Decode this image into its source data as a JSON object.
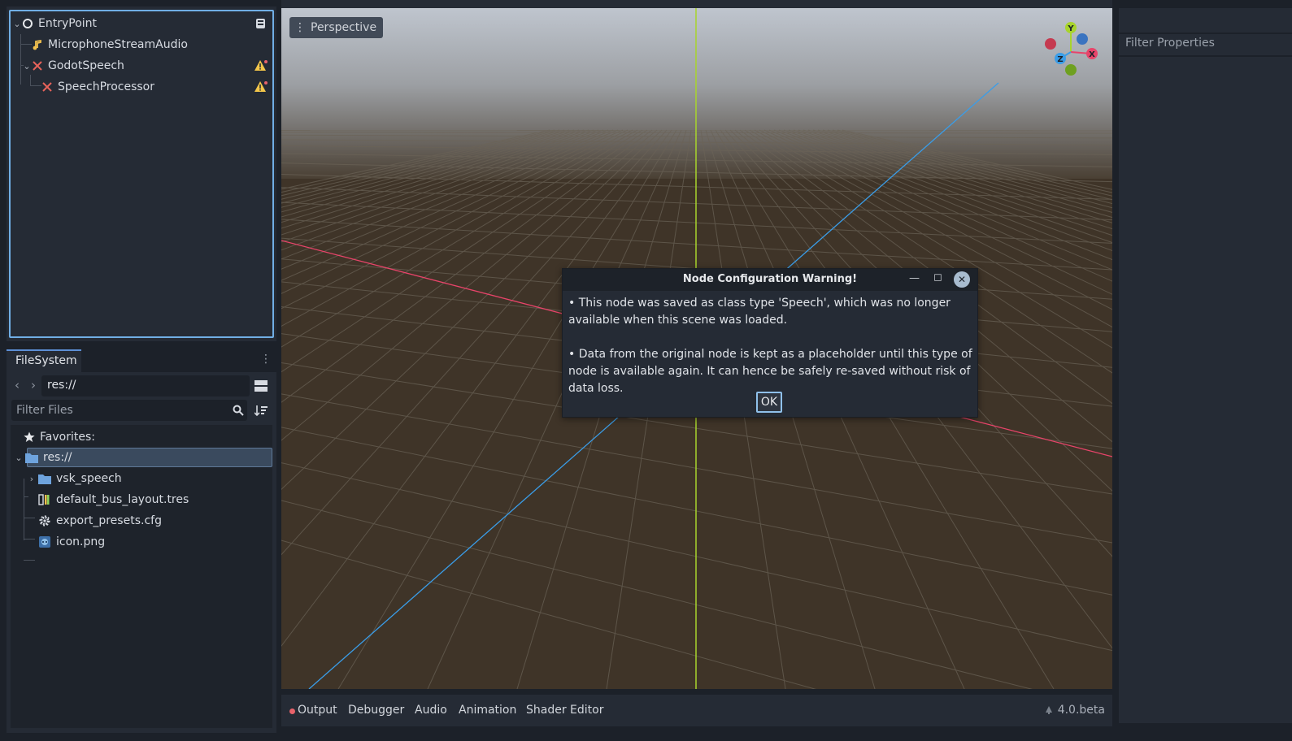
{
  "scene_tree": {
    "nodes": [
      {
        "label": "EntryPoint",
        "icon": "node3d-circle-icon"
      },
      {
        "label": "MicrophoneStreamAudio",
        "icon": "audio-stream-icon"
      },
      {
        "label": "GodotSpeech",
        "icon": "missing-node-icon",
        "warning": true
      },
      {
        "label": "SpeechProcessor",
        "icon": "missing-node-icon",
        "warning": true
      }
    ]
  },
  "filesystem": {
    "tab_label": "FileSystem",
    "path": "res://",
    "filter_placeholder": "Filter Files",
    "favorites_label": "Favorites:",
    "items": [
      {
        "label": "res://",
        "icon": "folder-icon"
      },
      {
        "label": "vsk_speech",
        "icon": "folder-icon"
      },
      {
        "label": "default_bus_layout.tres",
        "icon": "bus-layout-icon"
      },
      {
        "label": "export_presets.cfg",
        "icon": "gear-icon"
      },
      {
        "label": "icon.png",
        "icon": "image-icon"
      }
    ]
  },
  "viewport": {
    "perspective_label": "Perspective",
    "gizmo": {
      "x": "X",
      "y": "Y",
      "z": "Z"
    },
    "colors": {
      "x_axis": "#e8446a",
      "y_axis": "#a8d42c",
      "z_axis": "#3a9de8"
    }
  },
  "dialog": {
    "title": "Node Configuration Warning!",
    "message_1": "•  This node was saved as class type 'Speech', which was no longer available when this scene was loaded.",
    "message_2": "•  Data from the original node is kept as a placeholder until this type of node is available again. It can hence be safely re-saved without risk of data loss.",
    "ok_label": "OK"
  },
  "bottom_panel": {
    "tabs": [
      "Output",
      "Debugger",
      "Audio",
      "Animation",
      "Shader Editor"
    ],
    "version": "4.0.beta"
  },
  "inspector": {
    "filter_placeholder": "Filter Properties"
  }
}
